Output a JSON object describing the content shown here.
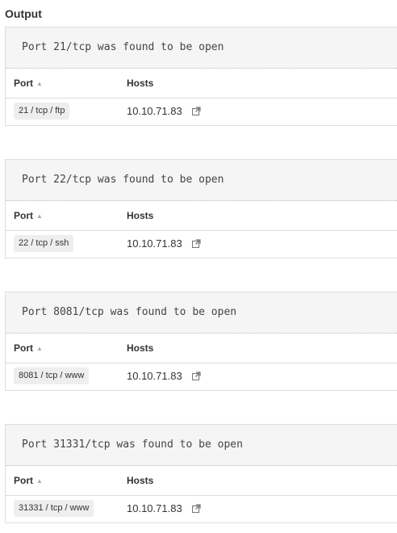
{
  "output": {
    "title": "Output",
    "columns": {
      "port": "Port",
      "hosts": "Hosts"
    },
    "sort_icon": "sort-ascending-icon",
    "findings": [
      {
        "message": "Port 21/tcp was found to be open",
        "port": "21 / tcp / ftp",
        "host": "10.10.71.83"
      },
      {
        "message": "Port 22/tcp was found to be open",
        "port": "22 / tcp / ssh",
        "host": "10.10.71.83"
      },
      {
        "message": "Port 8081/tcp was found to be open",
        "port": "8081 / tcp / www",
        "host": "10.10.71.83"
      },
      {
        "message": "Port 31331/tcp was found to be open",
        "port": "31331 / tcp / www",
        "host": "10.10.71.83"
      }
    ]
  }
}
